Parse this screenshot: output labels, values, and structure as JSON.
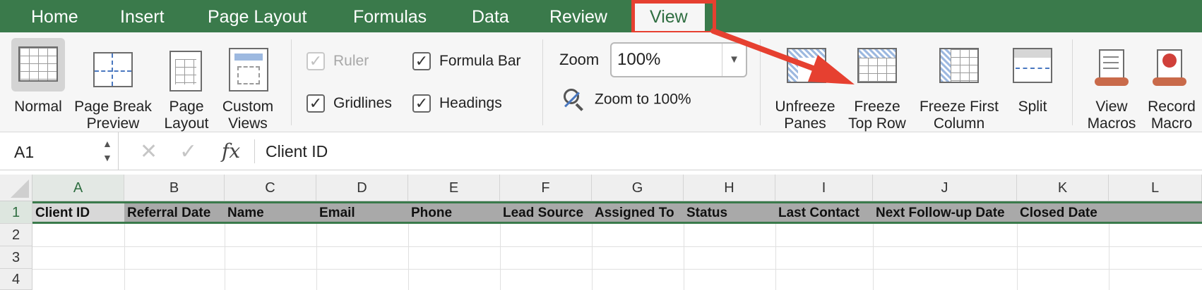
{
  "tabs": [
    {
      "label": "Home"
    },
    {
      "label": "Insert"
    },
    {
      "label": "Page Layout"
    },
    {
      "label": "Formulas"
    },
    {
      "label": "Data"
    },
    {
      "label": "Review"
    },
    {
      "label": "View",
      "active": true
    }
  ],
  "ribbon": {
    "workbook_views": [
      {
        "line1": "Normal",
        "line2": "",
        "selected": true
      },
      {
        "line1": "Page Break",
        "line2": "Preview"
      },
      {
        "line1": "Page",
        "line2": "Layout"
      },
      {
        "line1": "Custom",
        "line2": "Views"
      }
    ],
    "show": {
      "ruler": {
        "label": "Ruler",
        "checked": true,
        "disabled": true
      },
      "formula_bar": {
        "label": "Formula Bar",
        "checked": true
      },
      "gridlines": {
        "label": "Gridlines",
        "checked": true
      },
      "headings": {
        "label": "Headings",
        "checked": true
      }
    },
    "zoom": {
      "label": "Zoom",
      "value": "100%",
      "zoom_to_100_label": "Zoom to 100%"
    },
    "window": [
      {
        "line1": "Unfreeze",
        "line2": "Panes"
      },
      {
        "line1": "Freeze",
        "line2": "Top Row"
      },
      {
        "line1": "Freeze First",
        "line2": "Column"
      },
      {
        "line1": "Split",
        "line2": ""
      }
    ],
    "macros": [
      {
        "line1": "View",
        "line2": "Macros"
      },
      {
        "line1": "Record",
        "line2": "Macro"
      }
    ]
  },
  "formula_bar": {
    "name_box": "A1",
    "fx_symbol": "fx",
    "cancel_symbol": "✕",
    "enter_symbol": "✓",
    "content": "Client ID"
  },
  "grid": {
    "columns": [
      "A",
      "B",
      "C",
      "D",
      "E",
      "F",
      "G",
      "H",
      "I",
      "J",
      "K",
      "L"
    ],
    "rows": [
      "1",
      "2",
      "3",
      "4"
    ],
    "header_row": [
      "Client ID",
      "Referral Date",
      "Name",
      "Email",
      "Phone",
      "Lead Source",
      "Assigned To",
      "Status",
      "Last Contact",
      "Next Follow-up Date",
      "Closed Date",
      ""
    ]
  },
  "colors": {
    "tab_bar": "#3a7a4b",
    "annotation_red": "#e64030",
    "header_row_fill": "#a9a9a9"
  }
}
